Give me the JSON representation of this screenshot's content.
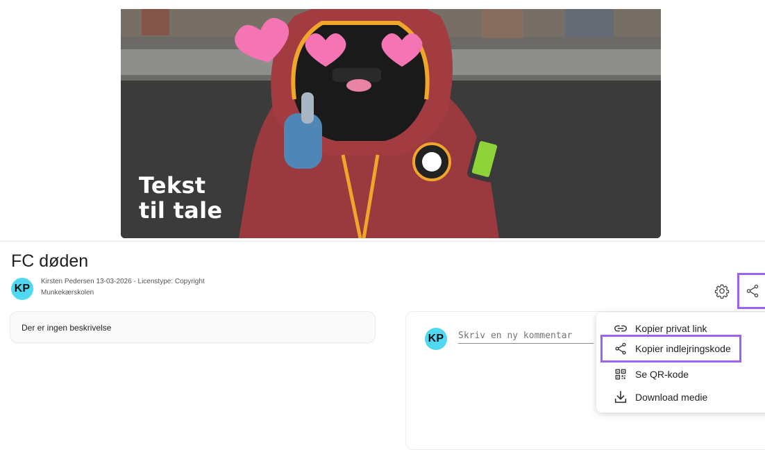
{
  "media": {
    "caption_line1": "Tekst",
    "caption_line2": "til tale"
  },
  "video": {
    "title": "FC døden",
    "author_initials": "KP",
    "meta_line": "Kirsten Pedersen 13-03-2026 - Licenstype: Copyright",
    "school": "Munkekærskolen"
  },
  "toolbar": {
    "settings_icon": "gear-icon",
    "share_icon": "share-icon"
  },
  "description": {
    "text": "Der er ingen beskrivelse"
  },
  "comments": {
    "user_initials": "KP",
    "placeholder": "Skriv en ny kommentar"
  },
  "share_menu": {
    "items": [
      {
        "label": "Kopier privat link",
        "icon": "link-icon"
      },
      {
        "label": "Kopier indlejringskode",
        "icon": "share-icon"
      },
      {
        "label": "Se QR-kode",
        "icon": "qr-code-icon"
      },
      {
        "label": "Download medie",
        "icon": "download-icon"
      }
    ]
  },
  "colors": {
    "highlight": "#9b63f4",
    "avatar": "#4fd8f0"
  }
}
